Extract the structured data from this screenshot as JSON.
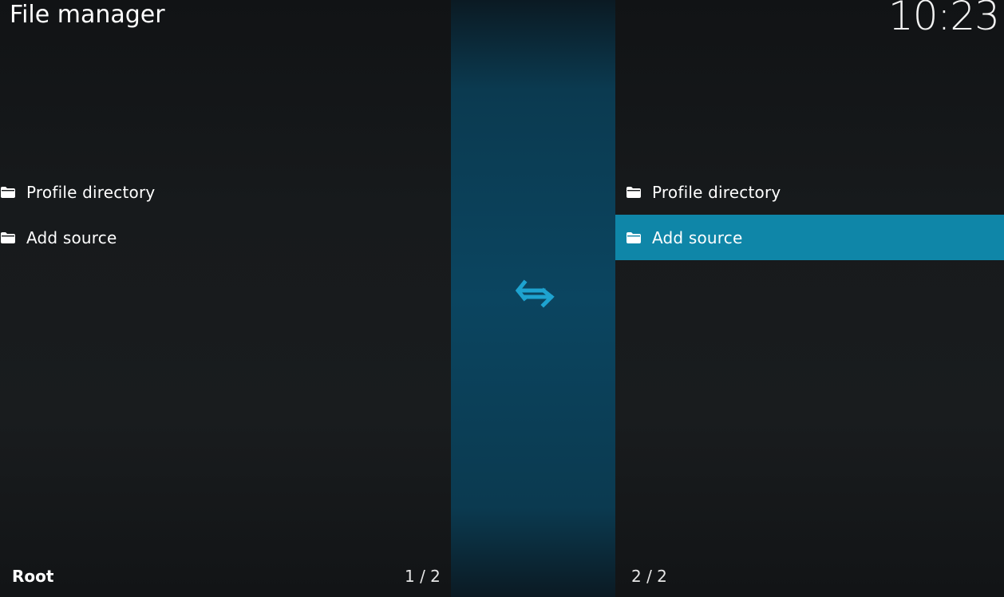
{
  "header": {
    "title": "File manager",
    "clock": "10:23"
  },
  "left_pane": {
    "items": [
      {
        "label": "Profile directory",
        "icon": "folder-icon"
      },
      {
        "label": "Add source",
        "icon": "folder-icon"
      }
    ],
    "path": "Root",
    "count": "1 / 2"
  },
  "right_pane": {
    "items": [
      {
        "label": "Profile directory",
        "icon": "folder-icon"
      },
      {
        "label": "Add source",
        "icon": "folder-icon",
        "focused": true
      }
    ],
    "count": "2 / 2"
  },
  "divider": {
    "icon": "swap-arrows-icon"
  },
  "colors": {
    "accent": "#0f86a8",
    "swap_icon": "#1ea3d0",
    "background": "#171a1c"
  }
}
